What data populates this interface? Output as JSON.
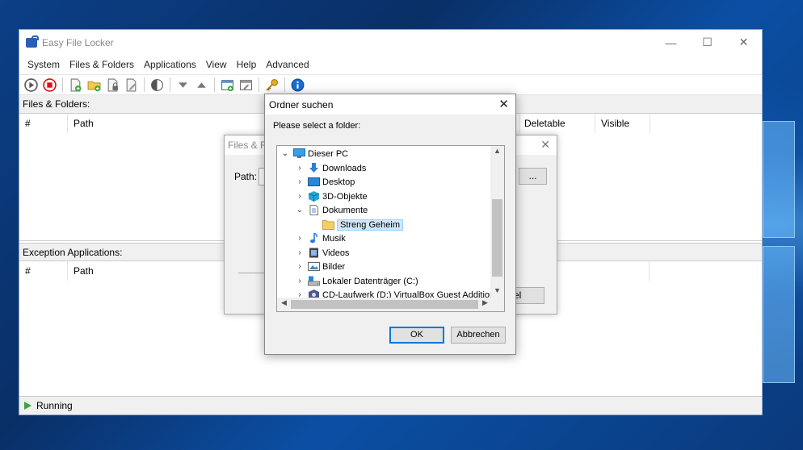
{
  "main_window": {
    "title": "Easy File Locker",
    "controls": {
      "minimize": "—",
      "maximize": "☐",
      "close": "✕"
    },
    "menu": [
      "System",
      "Files & Folders",
      "Applications",
      "View",
      "Help",
      "Advanced"
    ],
    "files_section": {
      "label": "Files & Folders:",
      "columns": [
        "#",
        "Path",
        "Deletable",
        "Visible"
      ]
    },
    "exceptions_section": {
      "label": "Exception Applications:",
      "columns": [
        "#",
        "Path"
      ]
    },
    "status": "Running"
  },
  "ff_dialog": {
    "title": "Files & Fo",
    "path_label": "Path:",
    "browse_label": "...",
    "cancel_label": "cel"
  },
  "folder_dialog": {
    "title": "Ordner suchen",
    "prompt": "Please select a folder:",
    "tree": [
      {
        "label": "Dieser PC",
        "chevron": "⌄",
        "icon": "pc-icon"
      },
      {
        "label": "Downloads",
        "chevron": "›",
        "icon": "downloads-icon"
      },
      {
        "label": "Desktop",
        "chevron": "›",
        "icon": "desktop-icon"
      },
      {
        "label": "3D-Objekte",
        "chevron": "›",
        "icon": "3d-objects-icon"
      },
      {
        "label": "Dokumente",
        "chevron": "⌄",
        "icon": "documents-icon"
      },
      {
        "label": "Streng Geheim",
        "chevron": "",
        "icon": "folder-icon"
      },
      {
        "label": "Musik",
        "chevron": "›",
        "icon": "music-icon"
      },
      {
        "label": "Videos",
        "chevron": "›",
        "icon": "videos-icon"
      },
      {
        "label": "Bilder",
        "chevron": "›",
        "icon": "pictures-icon"
      },
      {
        "label": "Lokaler Datenträger (C:)",
        "chevron": "›",
        "icon": "drive-icon"
      },
      {
        "label": "CD-Laufwerk (D:) VirtualBox Guest Additions",
        "chevron": "›",
        "icon": "cd-drive-icon"
      }
    ],
    "ok_label": "OK",
    "cancel_label": "Abbrechen"
  }
}
